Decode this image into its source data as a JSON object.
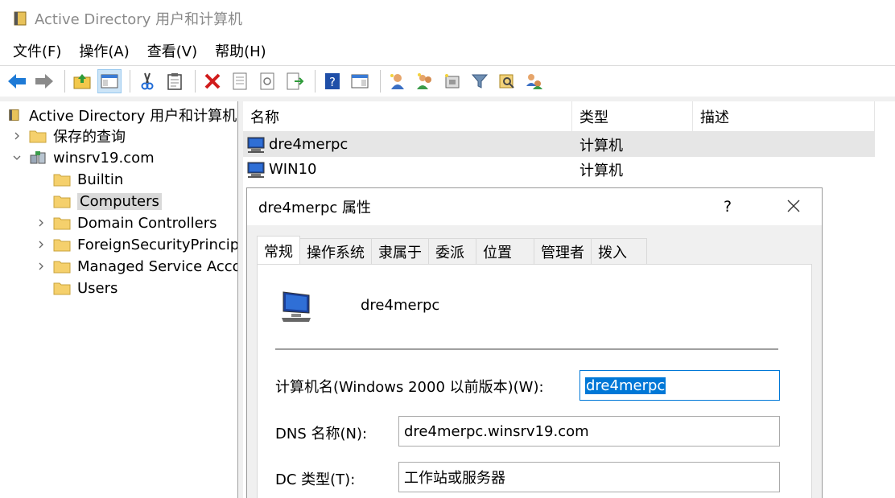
{
  "window": {
    "title": "Active Directory 用户和计算机"
  },
  "menu": [
    "文件(F)",
    "操作(A)",
    "查看(V)",
    "帮助(H)"
  ],
  "toolbar": {
    "buttons": [
      "back-icon",
      "forward-icon",
      "up-folder-icon",
      "show-tree-icon",
      "cut-icon",
      "paste-icon",
      "delete-icon",
      "properties-icon",
      "refresh-icon",
      "export-icon",
      "help-icon",
      "console-icon",
      "new-user-icon",
      "new-group-icon",
      "new-ou-icon",
      "filter-icon",
      "find-icon",
      "add-to-group-icon"
    ]
  },
  "tree": {
    "root": "Active Directory 用户和计算机 [",
    "saved_queries": "保存的查询",
    "domain": "winsrv19.com",
    "items": [
      "Builtin",
      "Computers",
      "Domain Controllers",
      "ForeignSecurityPrincipal",
      "Managed Service Accou",
      "Users"
    ]
  },
  "list": {
    "columns": [
      "名称",
      "类型",
      "描述"
    ],
    "rows": [
      {
        "name": "dre4merpc",
        "type": "计算机"
      },
      {
        "name": "WIN10",
        "type": "计算机"
      }
    ]
  },
  "dialog": {
    "title": "dre4merpc 属性",
    "help": "?",
    "tabs": [
      "常规",
      "操作系统",
      "隶属于",
      "委派",
      "位置",
      "管理者",
      "拨入"
    ],
    "computer_name": "dre4merpc",
    "labels": {
      "pre2000": "计算机名(Windows 2000 以前版本)(W):",
      "dns": "DNS 名称(N):",
      "dc_type": "DC 类型(T):"
    },
    "values": {
      "pre2000": "dre4merpc",
      "dns": "dre4merpc.winsrv19.com",
      "dc_type": "工作站或服务器"
    }
  }
}
